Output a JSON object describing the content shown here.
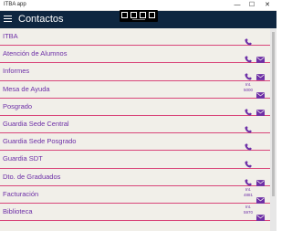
{
  "window": {
    "title": "ITBA app",
    "minimize_glyph": "—",
    "maximize_glyph": "☐",
    "close_glyph": "✕"
  },
  "appbar": {
    "title": "Contactos",
    "menu_icon": "hamburger-icon"
  },
  "colors": {
    "appbar": "#0e2640",
    "content_bg": "#f1efe9",
    "accent": "#6d2fa7",
    "separator": "#d9467a"
  },
  "contacts": [
    {
      "label": "ITBA",
      "phone": true,
      "mail": false,
      "ext_label": "",
      "ext": ""
    },
    {
      "label": "Atención de Alumnos",
      "phone": true,
      "mail": true,
      "ext_label": "",
      "ext": ""
    },
    {
      "label": "Informes",
      "phone": true,
      "mail": true,
      "ext_label": "",
      "ext": ""
    },
    {
      "label": "Mesa de Ayuda",
      "phone": false,
      "mail": true,
      "ext_label": "Int.",
      "ext": "5000"
    },
    {
      "label": "Posgrado",
      "phone": true,
      "mail": true,
      "ext_label": "",
      "ext": ""
    },
    {
      "label": "Guardia Sede Central",
      "phone": true,
      "mail": false,
      "ext_label": "",
      "ext": ""
    },
    {
      "label": "Guardia Sede Posgrado",
      "phone": true,
      "mail": false,
      "ext_label": "",
      "ext": ""
    },
    {
      "label": "Guardia SDT",
      "phone": true,
      "mail": false,
      "ext_label": "",
      "ext": ""
    },
    {
      "label": "Dto. de Graduados",
      "phone": true,
      "mail": true,
      "ext_label": "",
      "ext": ""
    },
    {
      "label": "Facturación",
      "phone": false,
      "mail": true,
      "ext_label": "Int.",
      "ext": "4881"
    },
    {
      "label": "Biblioteca",
      "phone": false,
      "mail": true,
      "ext_label": "Int.",
      "ext": "5970"
    }
  ]
}
